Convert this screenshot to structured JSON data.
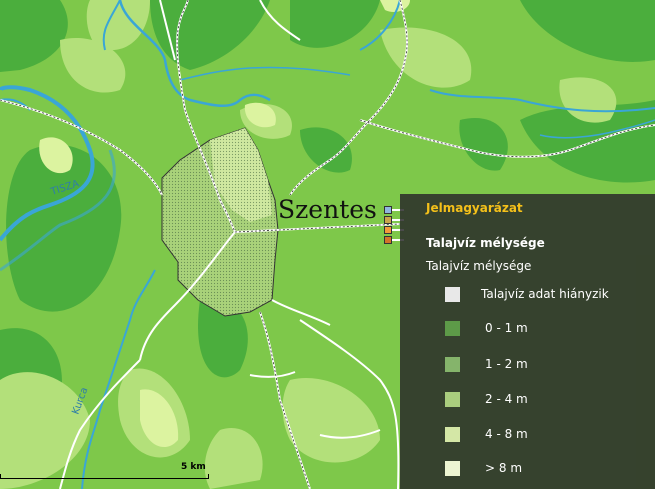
{
  "map": {
    "city_label": "Szentes",
    "river_label_tisza": "TISZA",
    "river_label_kurca": "Kurca",
    "colors": {
      "base": "#7ec84a",
      "light": "#b3e07a",
      "lighter": "#dcf3a0",
      "dark": "#4bae3d",
      "water": "#3aa6d6",
      "road": "#ffffff"
    }
  },
  "legend": {
    "title": "Jelmagyarázat",
    "layer_title": "Talajvíz mélysége",
    "subtitle": "Talajvíz mélysége",
    "items": [
      {
        "label": "Talajvíz adat hiányzik",
        "color": "#e8e8e8"
      },
      {
        "label": "0 - 1 m",
        "color": "#5d9a48"
      },
      {
        "label": "1 - 2 m",
        "color": "#85b46b"
      },
      {
        "label": "2 - 4 m",
        "color": "#aacd7e"
      },
      {
        "label": "4 - 8 m",
        "color": "#d4e7a6"
      },
      {
        "label": "> 8 m",
        "color": "#edf5d2"
      }
    ]
  },
  "scalebar": {
    "label": "5 km"
  }
}
